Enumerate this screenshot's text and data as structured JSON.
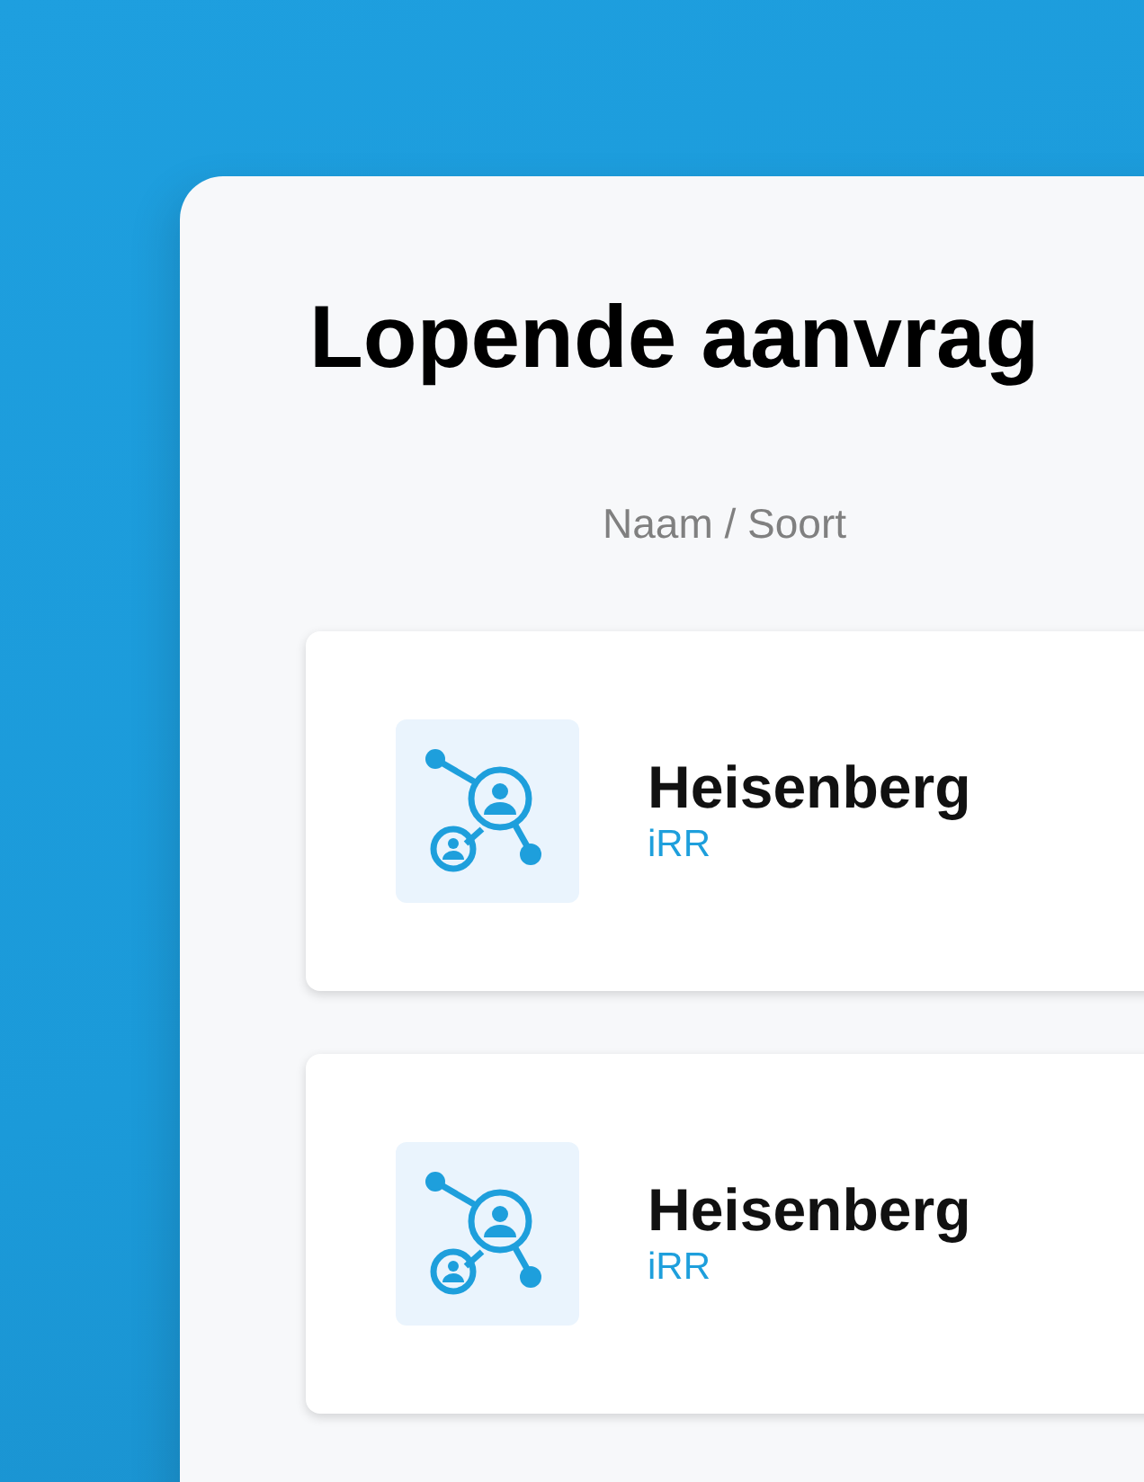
{
  "title": "Lopende aanvrag",
  "column_header": "Naam / Soort",
  "requests": [
    {
      "name": "Heisenberg",
      "type": "iRR"
    },
    {
      "name": "Heisenberg",
      "type": "iRR"
    }
  ]
}
